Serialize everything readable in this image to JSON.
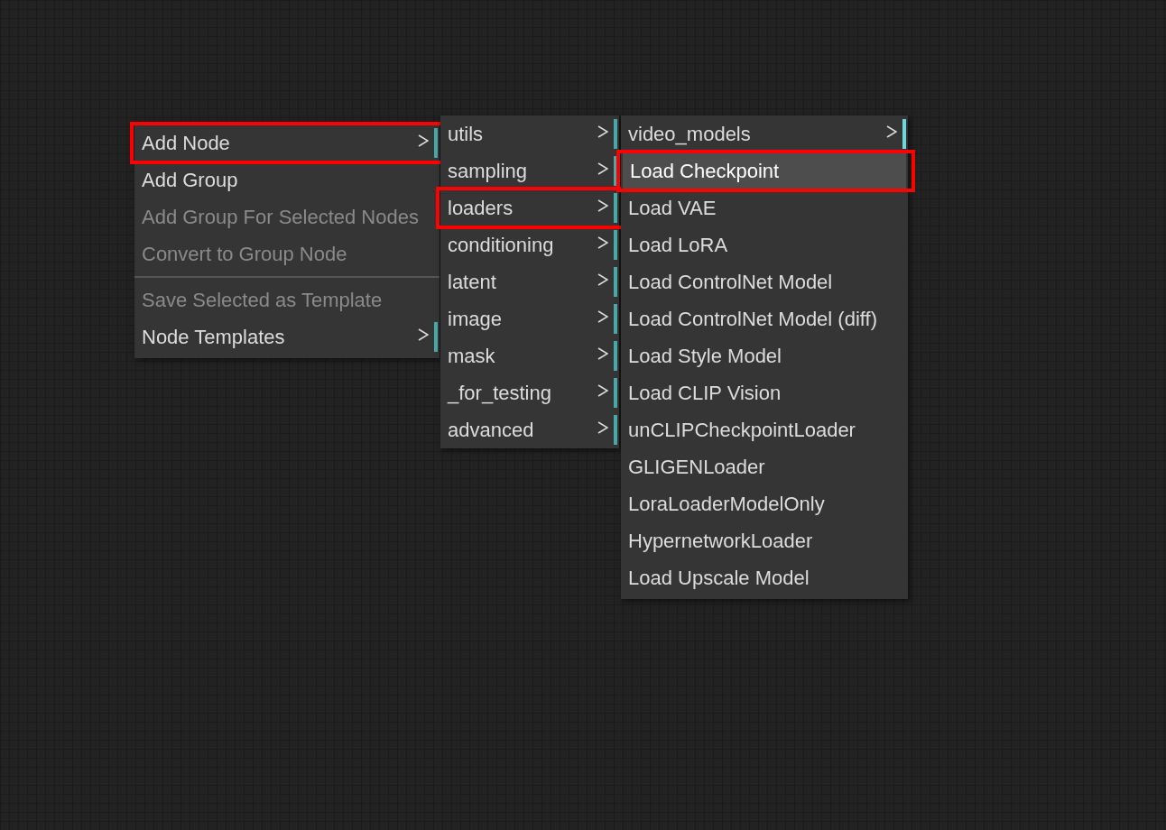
{
  "menus": [
    {
      "items": [
        {
          "kind": "item",
          "label": "Add Node",
          "disabled": false,
          "submenu": true,
          "hovered": false,
          "highlighted": true
        },
        {
          "kind": "item",
          "label": "Add Group",
          "disabled": false,
          "submenu": false,
          "hovered": false,
          "highlighted": false
        },
        {
          "kind": "item",
          "label": "Add Group For Selected Nodes",
          "disabled": true,
          "submenu": false,
          "hovered": false,
          "highlighted": false
        },
        {
          "kind": "item",
          "label": "Convert to Group Node",
          "disabled": true,
          "submenu": false,
          "hovered": false,
          "highlighted": false
        },
        {
          "kind": "separator"
        },
        {
          "kind": "item",
          "label": "Save Selected as Template",
          "disabled": true,
          "submenu": false,
          "hovered": false,
          "highlighted": false
        },
        {
          "kind": "item",
          "label": "Node Templates",
          "disabled": false,
          "submenu": true,
          "hovered": false,
          "highlighted": false
        }
      ]
    },
    {
      "items": [
        {
          "kind": "item",
          "label": "utils",
          "disabled": false,
          "submenu": true,
          "hovered": false,
          "highlighted": false
        },
        {
          "kind": "item",
          "label": "sampling",
          "disabled": false,
          "submenu": true,
          "hovered": false,
          "highlighted": false
        },
        {
          "kind": "item",
          "label": "loaders",
          "disabled": false,
          "submenu": true,
          "hovered": false,
          "highlighted": true
        },
        {
          "kind": "item",
          "label": "conditioning",
          "disabled": false,
          "submenu": true,
          "hovered": false,
          "highlighted": false
        },
        {
          "kind": "item",
          "label": "latent",
          "disabled": false,
          "submenu": true,
          "hovered": false,
          "highlighted": false
        },
        {
          "kind": "item",
          "label": "image",
          "disabled": false,
          "submenu": true,
          "hovered": false,
          "highlighted": false
        },
        {
          "kind": "item",
          "label": "mask",
          "disabled": false,
          "submenu": true,
          "hovered": false,
          "highlighted": false
        },
        {
          "kind": "item",
          "label": "_for_testing",
          "disabled": false,
          "submenu": true,
          "hovered": false,
          "highlighted": false
        },
        {
          "kind": "item",
          "label": "advanced",
          "disabled": false,
          "submenu": true,
          "hovered": false,
          "highlighted": false
        }
      ]
    },
    {
      "items": [
        {
          "kind": "item",
          "label": "video_models",
          "disabled": false,
          "submenu": true,
          "hovered": false,
          "highlighted": false
        },
        {
          "kind": "item",
          "label": "Load Checkpoint",
          "disabled": false,
          "submenu": false,
          "hovered": true,
          "highlighted": true
        },
        {
          "kind": "item",
          "label": "Load VAE",
          "disabled": false,
          "submenu": false,
          "hovered": false,
          "highlighted": false
        },
        {
          "kind": "item",
          "label": "Load LoRA",
          "disabled": false,
          "submenu": false,
          "hovered": false,
          "highlighted": false
        },
        {
          "kind": "item",
          "label": "Load ControlNet Model",
          "disabled": false,
          "submenu": false,
          "hovered": false,
          "highlighted": false
        },
        {
          "kind": "item",
          "label": "Load ControlNet Model (diff)",
          "disabled": false,
          "submenu": false,
          "hovered": false,
          "highlighted": false
        },
        {
          "kind": "item",
          "label": "Load Style Model",
          "disabled": false,
          "submenu": false,
          "hovered": false,
          "highlighted": false
        },
        {
          "kind": "item",
          "label": "Load CLIP Vision",
          "disabled": false,
          "submenu": false,
          "hovered": false,
          "highlighted": false
        },
        {
          "kind": "item",
          "label": "unCLIPCheckpointLoader",
          "disabled": false,
          "submenu": false,
          "hovered": false,
          "highlighted": false
        },
        {
          "kind": "item",
          "label": "GLIGENLoader",
          "disabled": false,
          "submenu": false,
          "hovered": false,
          "highlighted": false
        },
        {
          "kind": "item",
          "label": "LoraLoaderModelOnly",
          "disabled": false,
          "submenu": false,
          "hovered": false,
          "highlighted": false
        },
        {
          "kind": "item",
          "label": "HypernetworkLoader",
          "disabled": false,
          "submenu": false,
          "hovered": false,
          "highlighted": false
        },
        {
          "kind": "item",
          "label": "Load Upscale Model",
          "disabled": false,
          "submenu": false,
          "hovered": false,
          "highlighted": false
        }
      ]
    }
  ]
}
